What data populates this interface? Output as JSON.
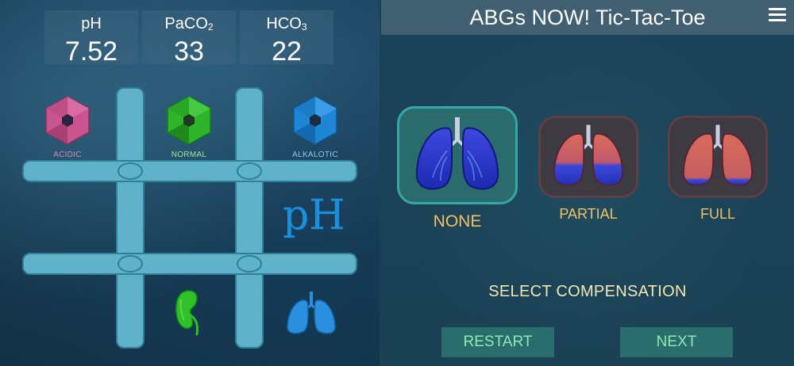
{
  "app": {
    "title": "ABGs NOW! Tic-Tac-Toe"
  },
  "stats": [
    {
      "label": "pH",
      "subscript": "",
      "value": "7.52"
    },
    {
      "label": "PaCO",
      "subscript": "2",
      "value": "33"
    },
    {
      "label": "HCO",
      "subscript": "3",
      "value": "22"
    }
  ],
  "board": {
    "tiles": [
      {
        "caption": "ACIDIC",
        "color": "#c8558f",
        "icon": "hexagon-icon"
      },
      {
        "caption": "NORMAL",
        "color": "#2fb52c",
        "icon": "hexagon-icon"
      },
      {
        "caption": "ALKALOTIC",
        "color": "#1f86d6",
        "icon": "hexagon-icon"
      }
    ],
    "ph_mark": "pH",
    "kidney_color": "#2fc02a",
    "lungs_color": "#2b8fe0"
  },
  "compensation": {
    "options": [
      {
        "label": "NONE",
        "selected": true
      },
      {
        "label": "PARTIAL",
        "selected": false
      },
      {
        "label": "FULL",
        "selected": false
      }
    ],
    "prompt": "SELECT COMPENSATION"
  },
  "buttons": {
    "restart": "RESTART",
    "next": "NEXT"
  },
  "colors": {
    "label_gold": "#f0c063",
    "button_text": "#8ee8b4",
    "button_bg": "#2b6c6c",
    "board_bar": "#5fb2c8"
  }
}
